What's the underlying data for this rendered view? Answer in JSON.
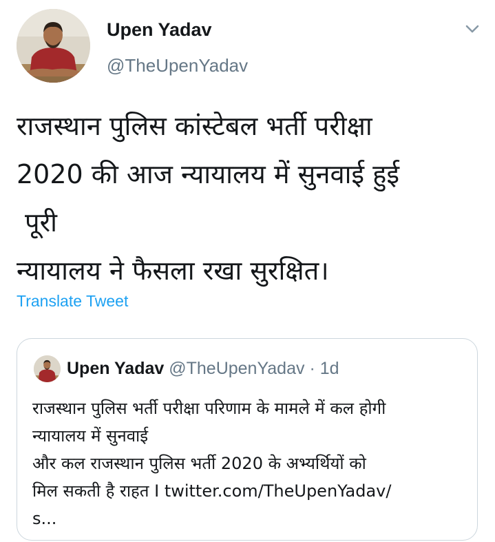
{
  "tweet": {
    "author": {
      "name": "Upen Yadav",
      "handle": "@TheUpenYadav",
      "avatar_icon": "profile-photo"
    },
    "menu_icon": "chevron-down-icon",
    "text_lines": [
      "राजस्थान पुलिस कांस्टेबल भर्ती परीक्षा",
      "2020 की आज न्यायालय में सुनवाई हुई",
      "पूरी",
      "न्यायालय ने फैसला रखा सुरक्षित।"
    ],
    "translate_label": "Translate Tweet"
  },
  "quoted_tweet": {
    "name": "Upen Yadav",
    "handle": "@TheUpenYadav",
    "separator": "·",
    "time": "1d",
    "text_lines": [
      "राजस्थान पुलिस भर्ती परीक्षा परिणाम के मामले में कल होगी",
      "न्यायालय में सुनवाई",
      "और कल राजस्थान पुलिस भर्ती 2020 के अभ्यर्थियों को",
      "मिल सकती है राहत I twitter.com/TheUpenYadav/",
      "s..."
    ]
  },
  "colors": {
    "text": "#14171a",
    "secondary": "#657786",
    "link": "#1da1f2",
    "border": "#ccd6dd"
  }
}
